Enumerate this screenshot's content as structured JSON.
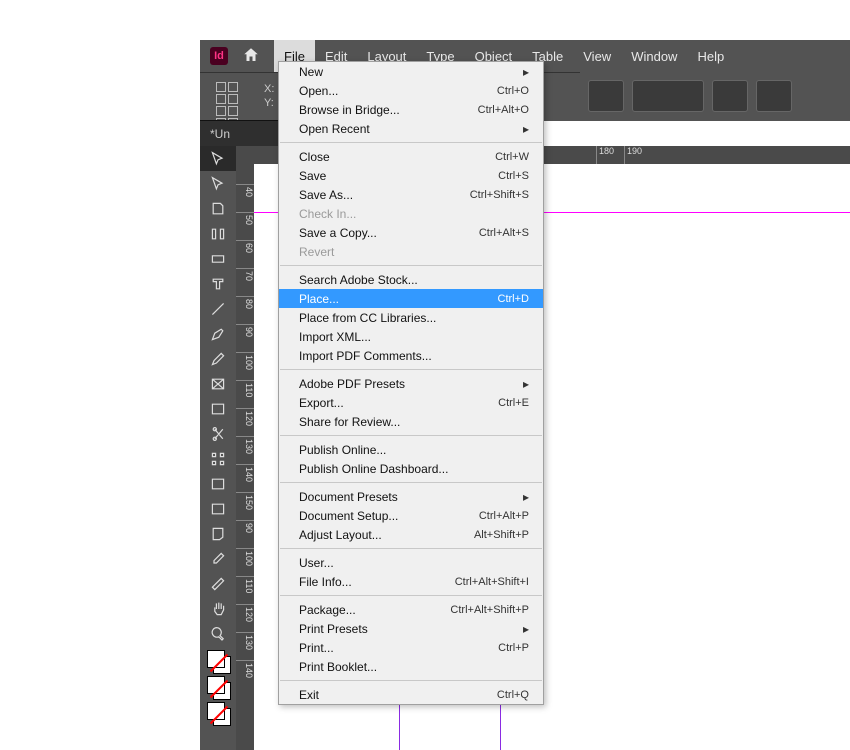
{
  "app_icon_text": "Id",
  "menubar": [
    "File",
    "Edit",
    "Layout",
    "Type",
    "Object",
    "Table",
    "View",
    "Window",
    "Help"
  ],
  "menubar_open_index": 0,
  "xy": {
    "x": "X:",
    "y": "Y:"
  },
  "doc_tab": "*Un",
  "hruler_ticks": [
    {
      "pos": 360,
      "label": "180"
    },
    {
      "pos": 388,
      "label": "190"
    }
  ],
  "vruler_ticks": [
    {
      "pos": 20,
      "label": "40"
    },
    {
      "pos": 48,
      "label": "50"
    },
    {
      "pos": 76,
      "label": "60"
    },
    {
      "pos": 104,
      "label": "70"
    },
    {
      "pos": 132,
      "label": "80"
    },
    {
      "pos": 160,
      "label": "90"
    },
    {
      "pos": 188,
      "label": "100"
    },
    {
      "pos": 216,
      "label": "110"
    },
    {
      "pos": 244,
      "label": "120"
    },
    {
      "pos": 272,
      "label": "130"
    },
    {
      "pos": 300,
      "label": "140"
    },
    {
      "pos": 328,
      "label": "150"
    },
    {
      "pos": 356,
      "label": "90"
    },
    {
      "pos": 384,
      "label": "100"
    },
    {
      "pos": 412,
      "label": "110"
    },
    {
      "pos": 440,
      "label": "120"
    },
    {
      "pos": 468,
      "label": "130"
    },
    {
      "pos": 496,
      "label": "140"
    }
  ],
  "file_menu": [
    {
      "type": "item",
      "label": "New",
      "shortcut": "",
      "submenu": true
    },
    {
      "type": "item",
      "label": "Open...",
      "shortcut": "Ctrl+O"
    },
    {
      "type": "item",
      "label": "Browse in Bridge...",
      "shortcut": "Ctrl+Alt+O"
    },
    {
      "type": "item",
      "label": "Open Recent",
      "shortcut": "",
      "submenu": true
    },
    {
      "type": "sep"
    },
    {
      "type": "item",
      "label": "Close",
      "shortcut": "Ctrl+W"
    },
    {
      "type": "item",
      "label": "Save",
      "shortcut": "Ctrl+S"
    },
    {
      "type": "item",
      "label": "Save As...",
      "shortcut": "Ctrl+Shift+S"
    },
    {
      "type": "item",
      "label": "Check In...",
      "shortcut": "",
      "disabled": true
    },
    {
      "type": "item",
      "label": "Save a Copy...",
      "shortcut": "Ctrl+Alt+S"
    },
    {
      "type": "item",
      "label": "Revert",
      "shortcut": "",
      "disabled": true
    },
    {
      "type": "sep"
    },
    {
      "type": "item",
      "label": "Search Adobe Stock..."
    },
    {
      "type": "item",
      "label": "Place...",
      "shortcut": "Ctrl+D",
      "highlight": true
    },
    {
      "type": "item",
      "label": "Place from CC Libraries..."
    },
    {
      "type": "item",
      "label": "Import XML..."
    },
    {
      "type": "item",
      "label": "Import PDF Comments..."
    },
    {
      "type": "sep"
    },
    {
      "type": "item",
      "label": "Adobe PDF Presets",
      "submenu": true
    },
    {
      "type": "item",
      "label": "Export...",
      "shortcut": "Ctrl+E"
    },
    {
      "type": "item",
      "label": "Share for Review..."
    },
    {
      "type": "sep"
    },
    {
      "type": "item",
      "label": "Publish Online..."
    },
    {
      "type": "item",
      "label": "Publish Online Dashboard..."
    },
    {
      "type": "sep"
    },
    {
      "type": "item",
      "label": "Document Presets",
      "submenu": true
    },
    {
      "type": "item",
      "label": "Document Setup...",
      "shortcut": "Ctrl+Alt+P"
    },
    {
      "type": "item",
      "label": "Adjust Layout...",
      "shortcut": "Alt+Shift+P"
    },
    {
      "type": "sep"
    },
    {
      "type": "item",
      "label": "User..."
    },
    {
      "type": "item",
      "label": "File Info...",
      "shortcut": "Ctrl+Alt+Shift+I"
    },
    {
      "type": "sep"
    },
    {
      "type": "item",
      "label": "Package...",
      "shortcut": "Ctrl+Alt+Shift+P"
    },
    {
      "type": "item",
      "label": "Print Presets",
      "submenu": true
    },
    {
      "type": "item",
      "label": "Print...",
      "shortcut": "Ctrl+P"
    },
    {
      "type": "item",
      "label": "Print Booklet..."
    },
    {
      "type": "sep"
    },
    {
      "type": "item",
      "label": "Exit",
      "shortcut": "Ctrl+Q"
    }
  ],
  "tools": [
    "selection",
    "direct-selection",
    "page",
    "gap",
    "content-collector",
    "type",
    "line",
    "pen",
    "pencil",
    "rectangle-frame",
    "rectangle",
    "scissors",
    "free-transform",
    "gradient-swatch",
    "gradient-feather",
    "note",
    "eyedropper",
    "measure",
    "hand",
    "zoom"
  ]
}
